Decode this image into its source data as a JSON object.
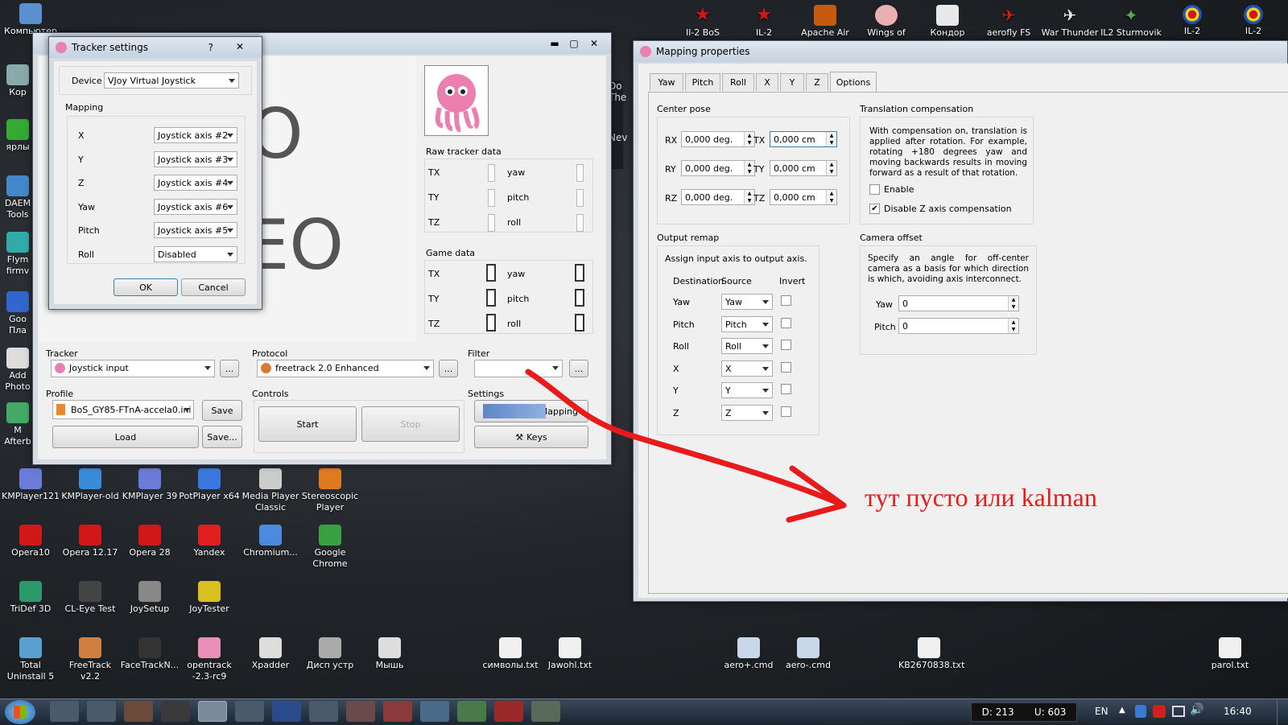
{
  "desktop_top": [
    {
      "label": "Компьютер"
    },
    {
      "label": "Il-2 BoS"
    },
    {
      "label": "IL-2"
    },
    {
      "label": "Apache Air"
    },
    {
      "label": "Wings of"
    },
    {
      "label": "Кондор"
    },
    {
      "label": "aerofly FS"
    },
    {
      "label": "War Thunder"
    },
    {
      "label": "IL2 Sturmovik"
    },
    {
      "label": "IL-2"
    },
    {
      "label": "IL-2"
    }
  ],
  "desktop_left": [
    {
      "label": "Кор"
    },
    {
      "label": "ярлы"
    },
    {
      "label": "DAEM Tools"
    },
    {
      "label": "Flym firmv"
    },
    {
      "label": "Goo Пла"
    },
    {
      "label": "Add Photo"
    },
    {
      "label": "M Afterb"
    }
  ],
  "desktop_grid": [
    {
      "label": "KMPlayer121",
      "color": "#6a7bd8"
    },
    {
      "label": "KMPlayer-old",
      "color": "#3a8bd8"
    },
    {
      "label": "KMPlayer 39",
      "color": "#6a7bd8"
    },
    {
      "label": "PotPlayer x64",
      "color": "#3a78e0"
    },
    {
      "label": "Media Player Classic",
      "color": "#cccccc"
    },
    {
      "label": "Stereoscopic Player",
      "color": "#e07a20"
    },
    {
      "label": "Opera10",
      "color": "#d01818"
    },
    {
      "label": "Opera 12.17",
      "color": "#d01818"
    },
    {
      "label": "Opera 28",
      "color": "#d01818"
    },
    {
      "label": "Yandex",
      "color": "#e02020"
    },
    {
      "label": "Chromium...",
      "color": "#4a8be0"
    },
    {
      "label": "Google Chrome",
      "color": "#3aa040"
    },
    {
      "label": "TriDef 3D",
      "color": "#2a9a6a"
    },
    {
      "label": "CL-Eye Test",
      "color": "#444444"
    },
    {
      "label": "JoySetup",
      "color": "#888888"
    },
    {
      "label": "JoyTester",
      "color": "#d8c020"
    },
    {
      "label": "Total Uninstall 5",
      "color": "#5aa0d0"
    },
    {
      "label": "FreeTrack v2.2",
      "color": "#d08040"
    },
    {
      "label": "FaceTrackN...",
      "color": "#333333"
    },
    {
      "label": "opentrack -2.3-rc9",
      "color": "#e890b8"
    },
    {
      "label": "Xpadder",
      "color": "#dddddd"
    },
    {
      "label": "Дисп устр",
      "color": "#aaaaaa"
    },
    {
      "label": "Мышь",
      "color": "#dddddd"
    },
    {
      "label": "символы.txt",
      "color": "#f0f0f0"
    },
    {
      "label": "Jawohl.txt",
      "color": "#f0f0f0"
    },
    {
      "label": "aero+.cmd",
      "color": "#c8d8e8"
    },
    {
      "label": "aero-.cmd",
      "color": "#c8d8e8"
    },
    {
      "label": "KB2670838.txt",
      "color": "#f0f0f0"
    },
    {
      "label": "parol.txt",
      "color": "#f0f0f0"
    }
  ],
  "bg_window_fragments": [
    "Do",
    "The",
    "Nev"
  ],
  "main": {
    "bg_letters1": "O",
    "bg_letters2": "EO",
    "raw_title": "Raw tracker data",
    "raw": [
      "TX",
      "TY",
      "TZ",
      "yaw",
      "pitch",
      "roll"
    ],
    "game_title": "Game data",
    "game": [
      "TX",
      "TY",
      "TZ",
      "yaw",
      "pitch",
      "roll"
    ],
    "tracker_label": "Tracker",
    "tracker_value": "Joystick input",
    "protocol_label": "Protocol",
    "protocol_value": "freetrack 2.0 Enhanced",
    "filter_label": "Filter",
    "filter_value": "",
    "profile_label": "Profile",
    "profile_value": "BoS_GY85-FTnA-accela0.ini",
    "save": "Save",
    "load": "Load",
    "save_as": "Save...",
    "controls_label": "Controls",
    "start": "Start",
    "stop": "Stop",
    "settings_label": "Settings",
    "mapping": "Mapping",
    "keys": "Keys",
    "dots": "..."
  },
  "tracker": {
    "title": "Tracker settings",
    "help": "?",
    "close": "✕",
    "device_label": "Device",
    "device_value": "VJoy Virtual Joystick",
    "mapping_label": "Mapping",
    "rows": [
      {
        "axis": "X",
        "value": "Joystick axis #2"
      },
      {
        "axis": "Y",
        "value": "Joystick axis #3"
      },
      {
        "axis": "Z",
        "value": "Joystick axis #4"
      },
      {
        "axis": "Yaw",
        "value": "Joystick axis #6"
      },
      {
        "axis": "Pitch",
        "value": "Joystick axis #5"
      },
      {
        "axis": "Roll",
        "value": "Disabled"
      }
    ],
    "ok": "OK",
    "cancel": "Cancel"
  },
  "mapping": {
    "title": "Mapping properties",
    "tabs": [
      "Yaw",
      "Pitch",
      "Roll",
      "X",
      "Y",
      "Z",
      "Options"
    ],
    "active_tab": "Options",
    "center_pose": "Center pose",
    "pose": [
      {
        "l": "RX",
        "v": "0,000 deg."
      },
      {
        "l": "RY",
        "v": "0,000 deg."
      },
      {
        "l": "RZ",
        "v": "0,000 deg."
      },
      {
        "l": "TX",
        "v": "0,000 cm"
      },
      {
        "l": "TY",
        "v": "0,000 cm"
      },
      {
        "l": "TZ",
        "v": "0,000 cm"
      }
    ],
    "trans_title": "Translation compensation",
    "trans_text": "With compensation on, translation is applied after rotation. For example, rotating +180 degrees yaw and moving backwards results in moving forward as a result of that rotation.",
    "enable": "Enable",
    "enable_checked": false,
    "disable_z": "Disable Z axis compensation",
    "disable_z_checked": true,
    "output_title": "Output remap",
    "output_hint": "Assign input axis to output axis.",
    "col_dest": "Destination",
    "col_src": "Source",
    "col_inv": "Invert",
    "remap": [
      {
        "d": "Yaw",
        "s": "Yaw"
      },
      {
        "d": "Pitch",
        "s": "Pitch"
      },
      {
        "d": "Roll",
        "s": "Roll"
      },
      {
        "d": "X",
        "s": "X"
      },
      {
        "d": "Y",
        "s": "Y"
      },
      {
        "d": "Z",
        "s": "Z"
      }
    ],
    "cam_title": "Camera offset",
    "cam_text": "Specify an angle for off-center camera as a basis for which direction is which, avoiding axis interconnect.",
    "cam_yaw": "Yaw",
    "cam_yaw_v": "0",
    "cam_pitch": "Pitch",
    "cam_pitch_v": "0"
  },
  "annotation": {
    "text": "тут пусто или kalman",
    "color": "#e81a1a"
  },
  "taskbar": {
    "d": "D: 213",
    "u": "U: 603",
    "lang": "EN",
    "time": "16:40"
  }
}
